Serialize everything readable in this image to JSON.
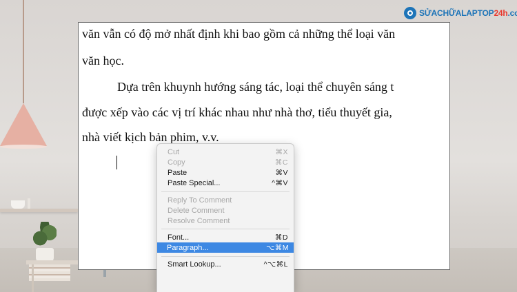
{
  "logo": {
    "part1": "SỬACHỮALAPTOP",
    "part2": "24h",
    "part3": ".com"
  },
  "document": {
    "lines": [
      "văn vẫn có độ mở nhất định khi bao gồm cả những thể loại văn",
      "văn học.",
      "Dựa trên khuynh hướng sáng tác, loại thể chuyên sáng t",
      "được xếp vào các vị trí khác nhau như nhà thơ, tiểu thuyết gia,",
      "nhà viết kịch bản phim, v.v."
    ]
  },
  "context_menu": {
    "items": [
      {
        "label": "Cut",
        "shortcut": "⌘X",
        "enabled": false
      },
      {
        "label": "Copy",
        "shortcut": "⌘C",
        "enabled": false
      },
      {
        "label": "Paste",
        "shortcut": "⌘V",
        "enabled": true
      },
      {
        "label": "Paste Special...",
        "shortcut": "^⌘V",
        "enabled": true
      },
      {
        "label": "Reply To Comment",
        "shortcut": "",
        "enabled": false
      },
      {
        "label": "Delete Comment",
        "shortcut": "",
        "enabled": false
      },
      {
        "label": "Resolve Comment",
        "shortcut": "",
        "enabled": false
      },
      {
        "label": "Font...",
        "shortcut": "⌘D",
        "enabled": true
      },
      {
        "label": "Paragraph...",
        "shortcut": "⌥⌘M",
        "enabled": true,
        "highlighted": true
      },
      {
        "label": "Smart Lookup...",
        "shortcut": "^⌥⌘L",
        "enabled": true
      }
    ]
  },
  "colors": {
    "highlight": "#3d88e3",
    "brand_blue": "#1d74b8",
    "brand_red": "#e8392f"
  }
}
